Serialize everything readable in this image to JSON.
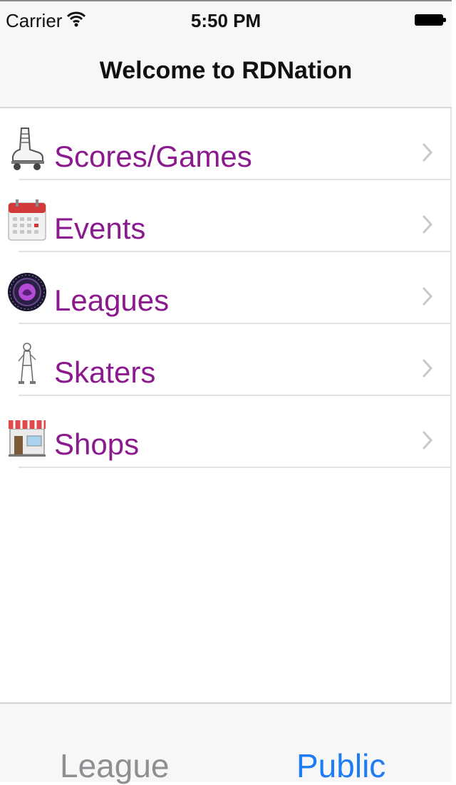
{
  "status_bar": {
    "carrier": "Carrier",
    "time": "5:50 PM",
    "icons": [
      "wifi-icon",
      "battery-icon"
    ]
  },
  "nav": {
    "title": "Welcome to RDNation"
  },
  "menu": {
    "items": [
      {
        "label": "Scores/Games",
        "icon": "roller-skate-icon"
      },
      {
        "label": "Events",
        "icon": "calendar-icon"
      },
      {
        "label": "Leagues",
        "icon": "league-logo-icon"
      },
      {
        "label": "Skaters",
        "icon": "skater-icon"
      },
      {
        "label": "Shops",
        "icon": "storefront-icon"
      }
    ],
    "label_color": "#8b1a8f"
  },
  "tab_bar": {
    "tabs": [
      {
        "label": "League",
        "selected": false
      },
      {
        "label": "Public",
        "selected": true
      }
    ],
    "selected_color": "#1e7df6",
    "unselected_color": "#8e8e93"
  }
}
